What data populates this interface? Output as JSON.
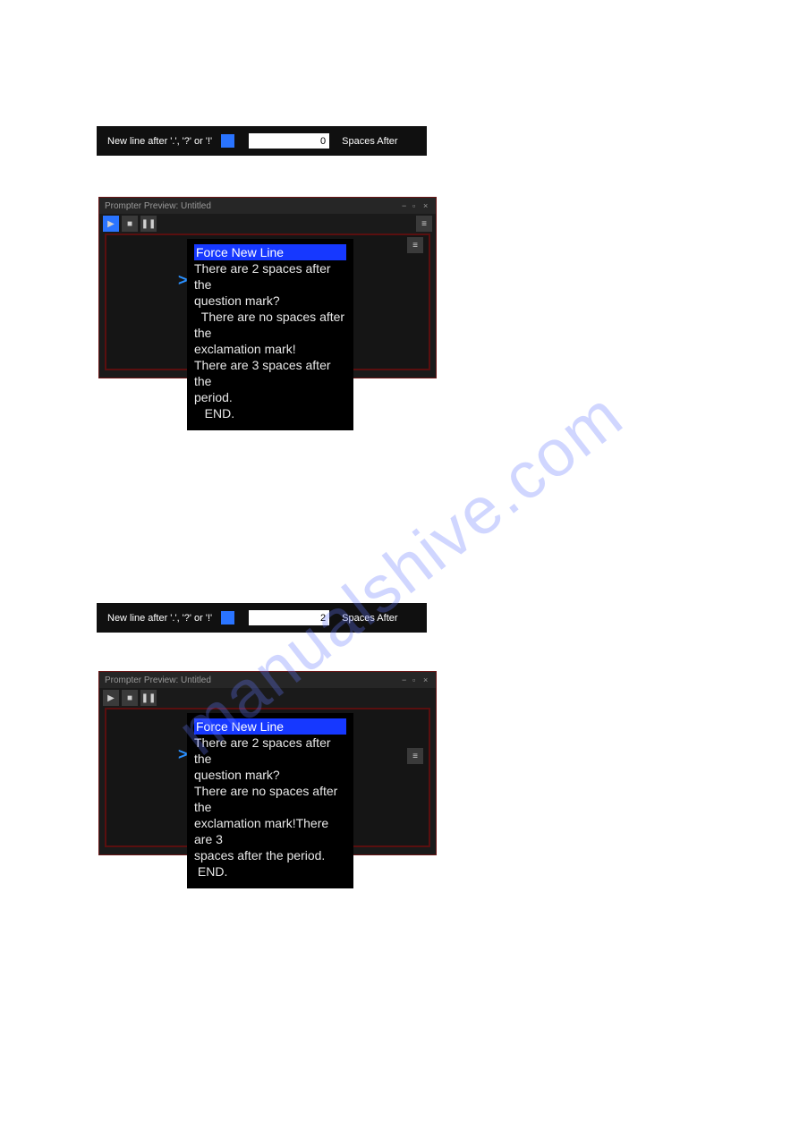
{
  "watermark": "manualshive.com",
  "bar1": {
    "label": "New line after '.', '?' or '!'",
    "checked": true,
    "spaces_value": "0",
    "spaces_label": "Spaces After"
  },
  "bar2": {
    "label": "New line after '.', '?' or '!'",
    "checked": true,
    "spaces_value": "2",
    "spaces_label": "Spaces After"
  },
  "preview1": {
    "title": "Prompter Preview: Untitled",
    "caret": ">",
    "force_line": "Force New Line",
    "line1": "There are 2 spaces after the",
    "line2": "question mark?",
    "line3": "  There are no spaces after the",
    "line4": "exclamation mark!",
    "line5": "There are 3 spaces after the",
    "line6": "period.",
    "line7": "   END."
  },
  "preview2": {
    "title": "Prompter Preview: Untitled",
    "caret": ">",
    "force_line": "Force New Line",
    "line1": "There are 2 spaces after the",
    "line2": "question mark?",
    "line3": "There are no spaces after the",
    "line4": "exclamation mark!There are 3",
    "line5": "spaces after the period.",
    "line6": " END."
  },
  "icons": {
    "play": "▶",
    "stop": "■",
    "pause": "❚❚",
    "menu": "≡",
    "min": "−",
    "max": "▫",
    "close": "×"
  }
}
